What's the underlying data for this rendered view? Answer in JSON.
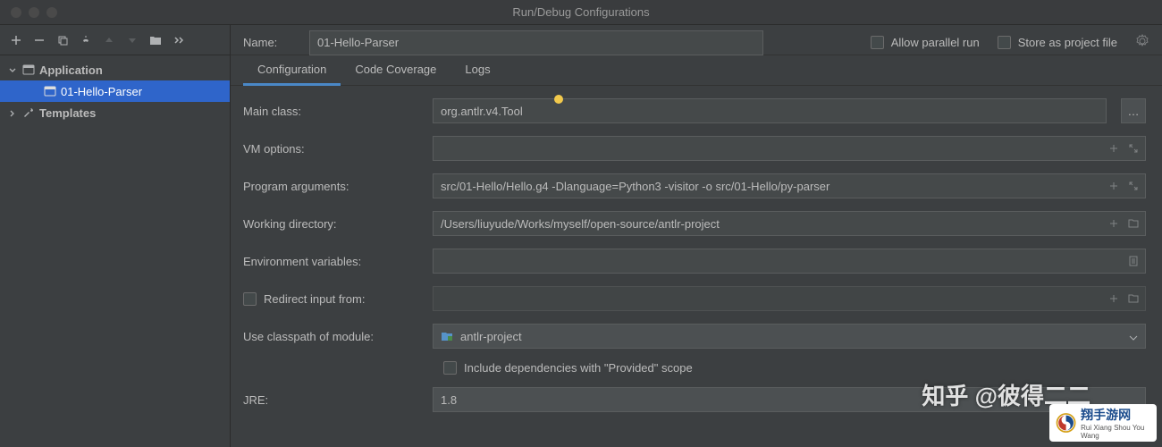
{
  "window": {
    "title": "Run/Debug Configurations"
  },
  "sidebar": {
    "application_label": "Application",
    "selected_item": "01-Hello-Parser",
    "templates_label": "Templates"
  },
  "header": {
    "name_label": "Name:",
    "name_value": "01-Hello-Parser",
    "allow_parallel": "Allow parallel run",
    "store_as_project": "Store as project file"
  },
  "tabs": {
    "configuration": "Configuration",
    "code_coverage": "Code Coverage",
    "logs": "Logs"
  },
  "form": {
    "main_class_label": "Main class:",
    "main_class_value": "org.antlr.v4.Tool",
    "vm_options_label": "VM options:",
    "vm_options_value": "",
    "program_args_label": "Program arguments:",
    "program_args_value": "src/01-Hello/Hello.g4 -Dlanguage=Python3 -visitor -o src/01-Hello/py-parser",
    "working_dir_label": "Working directory:",
    "working_dir_value": "/Users/liuyude/Works/myself/open-source/antlr-project",
    "env_vars_label": "Environment variables:",
    "env_vars_value": "",
    "redirect_input_label": "Redirect input from:",
    "classpath_label": "Use classpath of module:",
    "classpath_value": "antlr-project",
    "include_deps_label": "Include dependencies with \"Provided\" scope",
    "jre_label": "JRE:",
    "jre_value": "1.8"
  },
  "watermark": "知乎 @彼得二二",
  "logo": {
    "cn": "翔手游网",
    "en": "Rui Xiang Shou You Wang"
  }
}
